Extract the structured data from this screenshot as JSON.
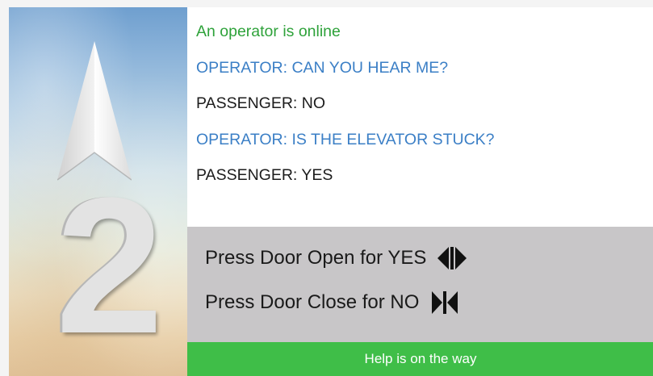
{
  "floor": {
    "number": "2",
    "direction_icon": "up-arrow-icon"
  },
  "chat": {
    "status": "An operator is online",
    "messages": [
      {
        "speaker": "operator",
        "text": "OPERATOR: CAN YOU HEAR ME?"
      },
      {
        "speaker": "passenger",
        "text": "PASSENGER: NO"
      },
      {
        "speaker": "operator",
        "text": "OPERATOR: IS THE ELEVATOR STUCK?"
      },
      {
        "speaker": "passenger",
        "text": "PASSENGER: YES"
      }
    ]
  },
  "prompts": {
    "yes_text": "Press Door Open for YES",
    "yes_icon": "door-open-icon",
    "no_text": "Press Door Close for NO",
    "no_icon": "door-close-icon"
  },
  "help": {
    "text": "Help is on the way"
  },
  "colors": {
    "status": "#2ea23a",
    "operator": "#3b7fc6",
    "passenger": "#1c1c1c",
    "prompt_panel": "#c8c6c8",
    "help_bar": "#3fbe48"
  }
}
